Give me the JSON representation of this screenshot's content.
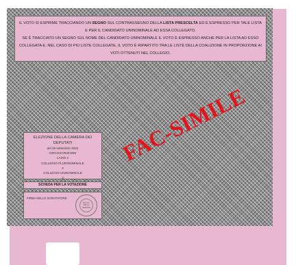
{
  "instructions": {
    "line1_pre": "Il voto si esprime tracciando un ",
    "line1_bold1": "segno",
    "line1_mid": " sul contrassegno della ",
    "line1_bold2": "lista prescelta",
    "line1_post": " ed è espresso per tale lista e per il candidato uninominale ad essa collegato.",
    "line2": "Se è tracciato un segno sul nome del candidato uninominale il voto è espresso anche per la lista ad esso collegata e, nel caso di più liste collegate, il voto è ripartito tra le liste della coalizione in proporzione ai voti ottenuti nel collegio."
  },
  "watermark": "FAC-SIMILE",
  "info_box": {
    "title": "ELEZIONE DELLA CAMERA DEI DEPUTATI",
    "date": "del 25 settembre 2022",
    "circoscrizione_label": "CIRCOSCRIZIONE",
    "circoscrizione_value": "LAZIO 2",
    "plurinominale_label": "COLLEGIO PLURINOMINALE",
    "plurinominale_value": "2",
    "uninominale_label": "COLLEGIO UNINOMINALE",
    "uninominale_value": "4"
  },
  "scheda_label": "SCHEDA PER LA VOTAZIONE",
  "firma_label": "FIRMA DELLO SCRUTATORE",
  "stamp_text": "BOLLO DELLA SEZIONE",
  "colors": {
    "sheet": "#e7b8cf",
    "watermark": "#e0161e",
    "hatch": "#8e8e8e"
  }
}
